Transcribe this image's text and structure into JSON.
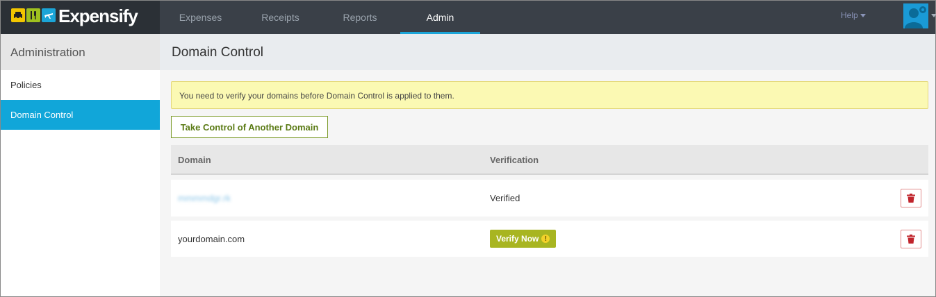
{
  "brand": {
    "name": "Expensify",
    "icons": [
      "taxi-icon",
      "fork-knife-icon",
      "airplane-icon"
    ]
  },
  "nav": {
    "items": [
      {
        "label": "Expenses"
      },
      {
        "label": "Receipts"
      },
      {
        "label": "Reports"
      },
      {
        "label": "Admin",
        "active": true
      }
    ],
    "help_label": "Help"
  },
  "sidebar": {
    "title": "Administration",
    "items": [
      {
        "label": "Policies"
      },
      {
        "label": "Domain Control",
        "active": true
      }
    ]
  },
  "main": {
    "title": "Domain Control",
    "notice": "You need to verify your domains before Domain Control is applied to them.",
    "take_control_label": "Take Control of Another Domain",
    "table": {
      "headers": {
        "domain": "Domain",
        "verification": "Verification"
      },
      "rows": [
        {
          "domain": "mmmmdgr.rk",
          "verification": "Verified"
        },
        {
          "domain": "yourdomain.com",
          "verification_action": "Verify Now",
          "warning": "!"
        }
      ]
    }
  },
  "colors": {
    "topbar": "#3a4048",
    "accent": "#11a6d9",
    "verify_green": "#a8b521",
    "delete_red": "#c0242c",
    "notice_bg": "#fbf9b3"
  }
}
